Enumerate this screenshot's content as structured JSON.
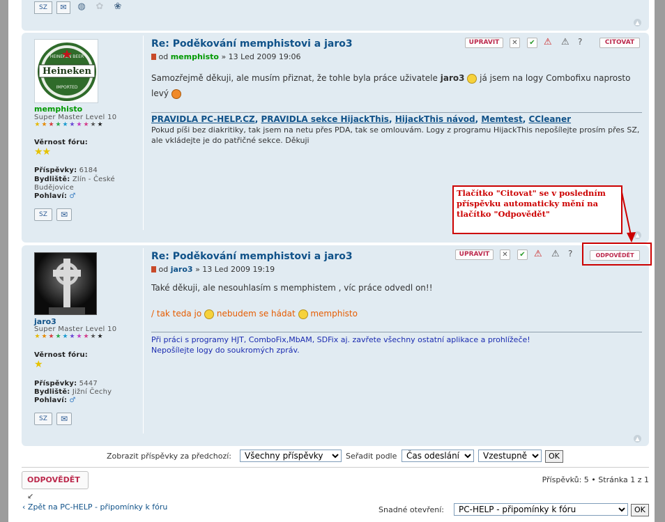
{
  "top_post_icons": [
    "contact-icon",
    "mail-icon",
    "www-icon",
    "icq-icon",
    "flower-icon"
  ],
  "post1": {
    "title": "Re: Poděkování memphistovi a jaro3",
    "meta_prefix": "od",
    "author": "memphisto",
    "date": "» 13 Led 2009 19:06",
    "username": "memphisto",
    "rank": "Super Master Level 10",
    "loyalty_label": "Věrnost fóru:",
    "posts_label": "Příspěvky:",
    "posts_value": "6184",
    "location_label": "Bydliště:",
    "location_value": "Zlín - České",
    "location_value2": "Budějovice",
    "gender_label": "Pohlaví:",
    "text_part1": "Samozřejmě děkuji, ale musím přiznat, že tohle byla práce uživatele",
    "text_user": "jaro3",
    "text_part2": "já jsem na logy Combofixu naprosto",
    "text_part3": "levý",
    "sig_links": [
      "PRAVIDLA PC-HELP.CZ",
      "PRAVIDLA sekce HijackThis",
      "HijackThis návod",
      "Memtest",
      "CCleaner"
    ],
    "sig_text": "Pokud píši bez diakritiky, tak jsem na netu přes PDA, tak se omlouvám. Logy z programu HijackThis nepošílejte prosím přes SZ, ale vkládejte je do patřičné sekce. Děkuji",
    "edit_label": "UPRAVIT",
    "quote_label": "CITOVAT"
  },
  "annotation": {
    "text": "Tlačítko \"Citovat\" se v posledním příspěvku automaticky mění na tlačítko \"Odpovědět\""
  },
  "post2": {
    "title": "Re: Poděkování memphistovi a jaro3",
    "meta_prefix": "od",
    "author": "jaro3",
    "date": "» 13 Led 2009 19:19",
    "username": "jaro3",
    "rank": "Super Master Level 10",
    "loyalty_label": "Věrnost fóru:",
    "posts_label": "Příspěvky:",
    "posts_value": "5447",
    "location_label": "Bydliště:",
    "location_value": "Jižní Čechy",
    "gender_label": "Pohlaví:",
    "text_line1": "Také děkuji, ale nesouhlasím s memphistem , víc práce odvedl on!!",
    "text_colored_a": "/ tak teda jo",
    "text_colored_b": "nebudem se hádat",
    "text_colored_c": "memphisto",
    "sig_line1": "Při práci s programy HJT, ComboFix,MbAM, SDFix aj. zavřete všechny ostatní aplikace a prohlížeče!",
    "sig_line2": "Nepošílejte logy do soukromých zpráv.",
    "edit_label": "UPRAVIT",
    "reply_label": "ODPOVĚDĚT"
  },
  "sort_bar": {
    "show_label": "Zobrazit příspěvky za předchozí:",
    "show_value": "Všechny příspěvky",
    "sort_label": "Seřadit podle",
    "sort_value": "Čas odeslání",
    "order_value": "Vzestupně",
    "ok_label": "OK"
  },
  "footer": {
    "reply_button": "ODPOVĚDĚT",
    "pagination": "Příspěvků: 5 • Stránka 1 z 1",
    "back_link": "Zpět na PC-HELP - připomínky k fóru",
    "jump_label": "Snadné otevření:",
    "jump_value": "PC-HELP - připomínky k fóru",
    "jump_ok": "OK"
  },
  "colors": {
    "post_bg": "#e1ebf2",
    "title": "#105289",
    "username_green": "#009900",
    "username_blue": "#105289",
    "annotation_red": "#cc0000",
    "reply_red": "#bc2a4d"
  }
}
